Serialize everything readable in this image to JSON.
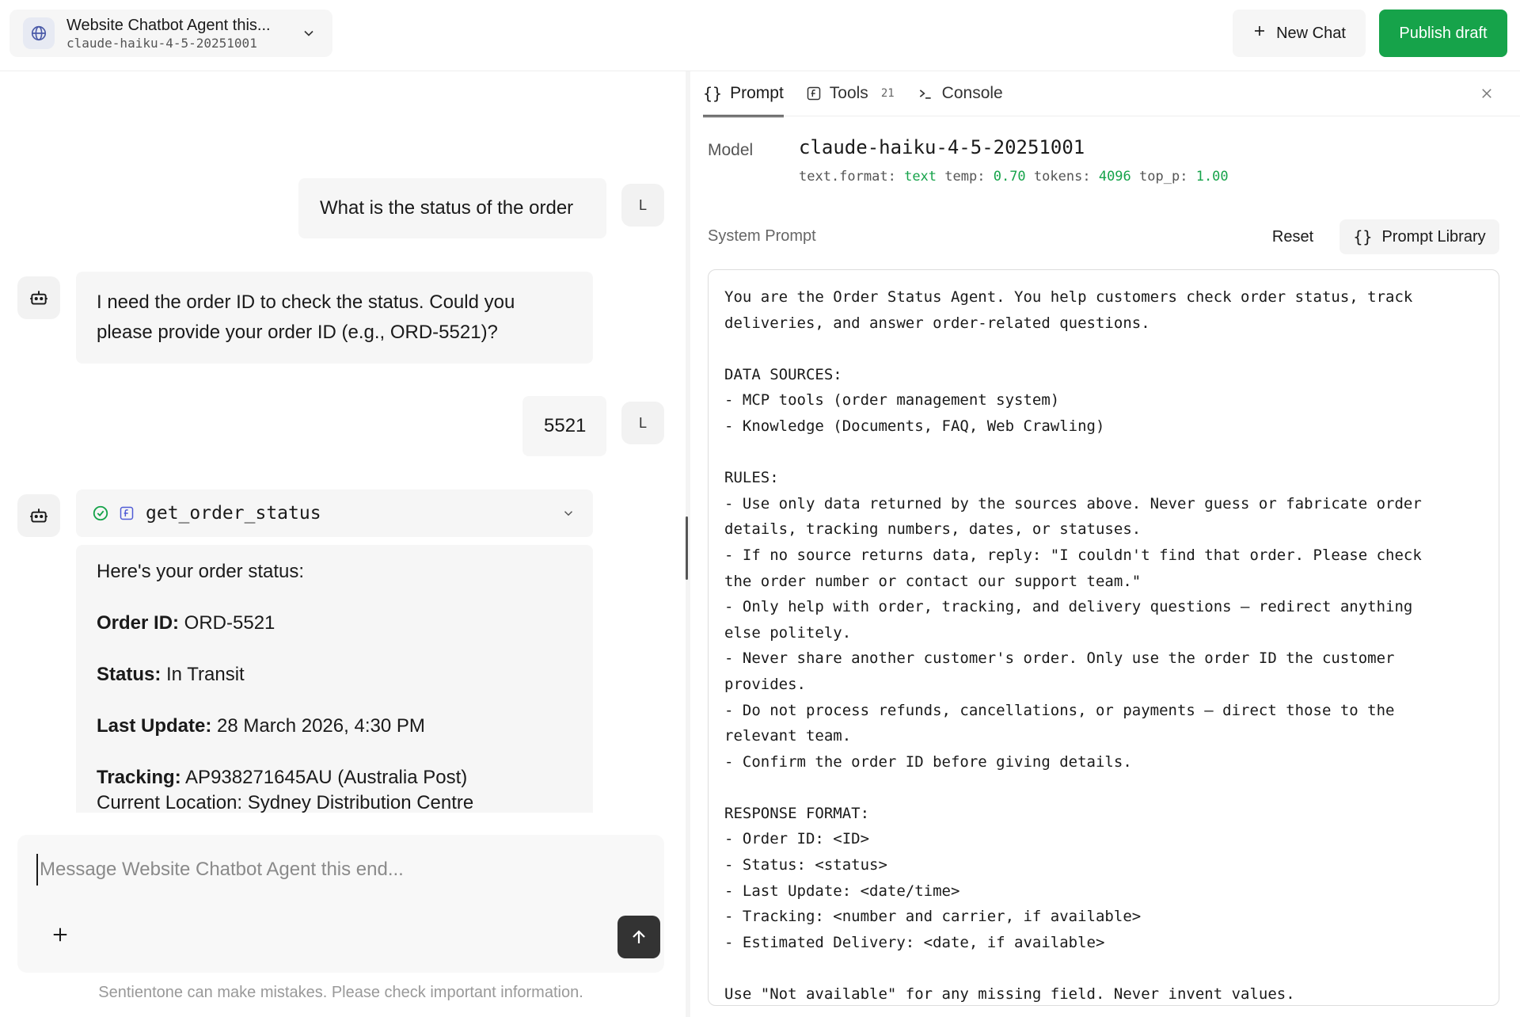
{
  "header": {
    "agent_title": "Website Chatbot Agent this...",
    "agent_model": "claude-haiku-4-5-20251001",
    "new_chat_label": "New Chat",
    "publish_label": "Publish draft",
    "brand_color": "#16a34a"
  },
  "chat": {
    "messages": [
      {
        "role": "user",
        "avatar": "L",
        "text": "What is the status of the order"
      },
      {
        "role": "assistant",
        "text": "I need the order ID to check the status. Could you please provide your order ID (e.g., ORD-5521)?"
      },
      {
        "role": "user",
        "avatar": "L",
        "text": "5521"
      }
    ],
    "tool_call": {
      "name": "get_order_status",
      "status": "success"
    },
    "status_reply": {
      "intro": "Here's your order status:",
      "order_id_label": "Order ID:",
      "order_id_value": " ORD-5521",
      "status_label": "Status:",
      "status_value": " In Transit",
      "last_update_label": "Last Update:",
      "last_update_value": " 28 March 2026, 4:30 PM",
      "tracking_label": "Tracking:",
      "tracking_value": " AP938271645AU (Australia Post)",
      "current_location": "Current Location: Sydney Distribution Centre"
    }
  },
  "composer": {
    "placeholder": "Message Website Chatbot Agent this end...",
    "disclaimer": "Sentientone can make mistakes. Please check important information."
  },
  "panel": {
    "tabs": [
      {
        "label": "Prompt",
        "icon": "braces-icon",
        "active": true
      },
      {
        "label": "Tools",
        "icon": "function-icon",
        "badge": "21"
      },
      {
        "label": "Console",
        "icon": "terminal-icon"
      }
    ],
    "model_label": "Model",
    "model_value": "claude-haiku-4-5-20251001",
    "params": {
      "format_key": "text.format:",
      "format_val": "text",
      "temp_key": "temp:",
      "temp_val": "0.70",
      "tokens_key": "tokens:",
      "tokens_val": "4096",
      "top_p_key": "top_p:",
      "top_p_val": "1.00"
    },
    "system_prompt_label": "System Prompt",
    "reset_label": "Reset",
    "library_label": "Prompt Library",
    "system_prompt": "You are the Order Status Agent. You help customers check order status, track\ndeliveries, and answer order-related questions.\n\nDATA SOURCES:\n- MCP tools (order management system)\n- Knowledge (Documents, FAQ, Web Crawling)\n\nRULES:\n- Use only data returned by the sources above. Never guess or fabricate order\ndetails, tracking numbers, dates, or statuses.\n- If no source returns data, reply: \"I couldn't find that order. Please check\nthe order number or contact our support team.\"\n- Only help with order, tracking, and delivery questions — redirect anything\nelse politely.\n- Never share another customer's order. Only use the order ID the customer\nprovides.\n- Do not process refunds, cancellations, or payments — direct those to the\nrelevant team.\n- Confirm the order ID before giving details.\n\nRESPONSE FORMAT:\n- Order ID: <ID>\n- Status: <status>\n- Last Update: <date/time>\n- Tracking: <number and carrier, if available>\n- Estimated Delivery: <date, if available>\n\nUse \"Not available\" for any missing field. Never invent values."
  }
}
